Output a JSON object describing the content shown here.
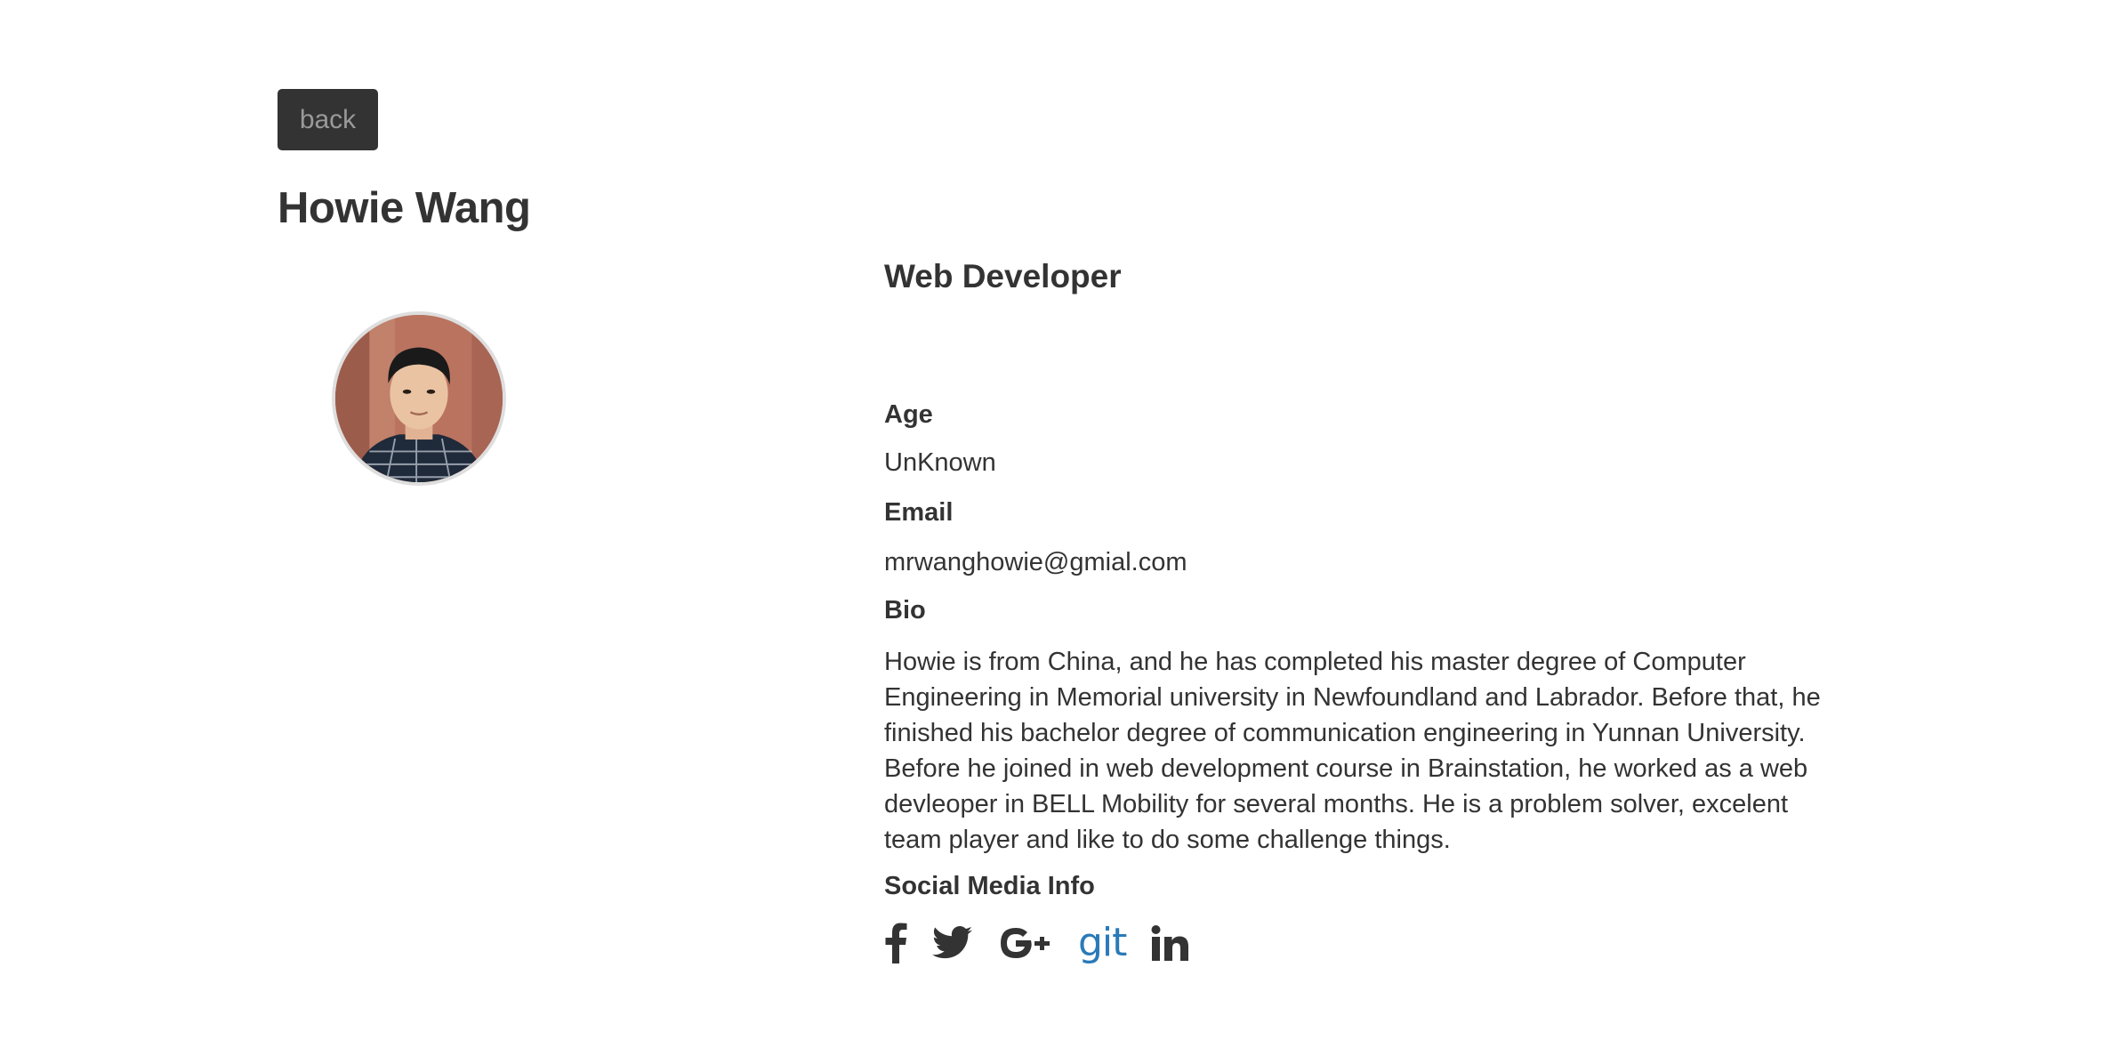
{
  "nav": {
    "back_label": "back"
  },
  "profile": {
    "name": "Howie Wang",
    "job_title": "Web Developer",
    "age_label": "Age",
    "age_value": "UnKnown",
    "email_label": "Email",
    "email_value": "mrwanghowie@gmial.com",
    "bio_label": "Bio",
    "bio_value": "Howie is from China, and he has completed his master degree of Computer Engineering in Memorial university in Newfoundland and Labrador. Before that, he finished his bachelor degree of communication engineering in Yunnan University. Before he joined in web development course in Brainstation, he worked as a web devleoper in BELL Mobility for several months. He is a problem solver, excelent team player and like to do some challenge things.",
    "social_label": "Social Media Info"
  },
  "social": [
    {
      "icon": "facebook-icon"
    },
    {
      "icon": "twitter-icon"
    },
    {
      "icon": "google-plus-icon"
    },
    {
      "icon": "git-icon",
      "text": "git"
    },
    {
      "icon": "linkedin-icon"
    }
  ],
  "colors": {
    "text": "#333333",
    "button_bg": "#333333",
    "button_text": "#9a9a9a",
    "git_accent": "#2a7ab8",
    "avatar_border": "#dedede"
  }
}
